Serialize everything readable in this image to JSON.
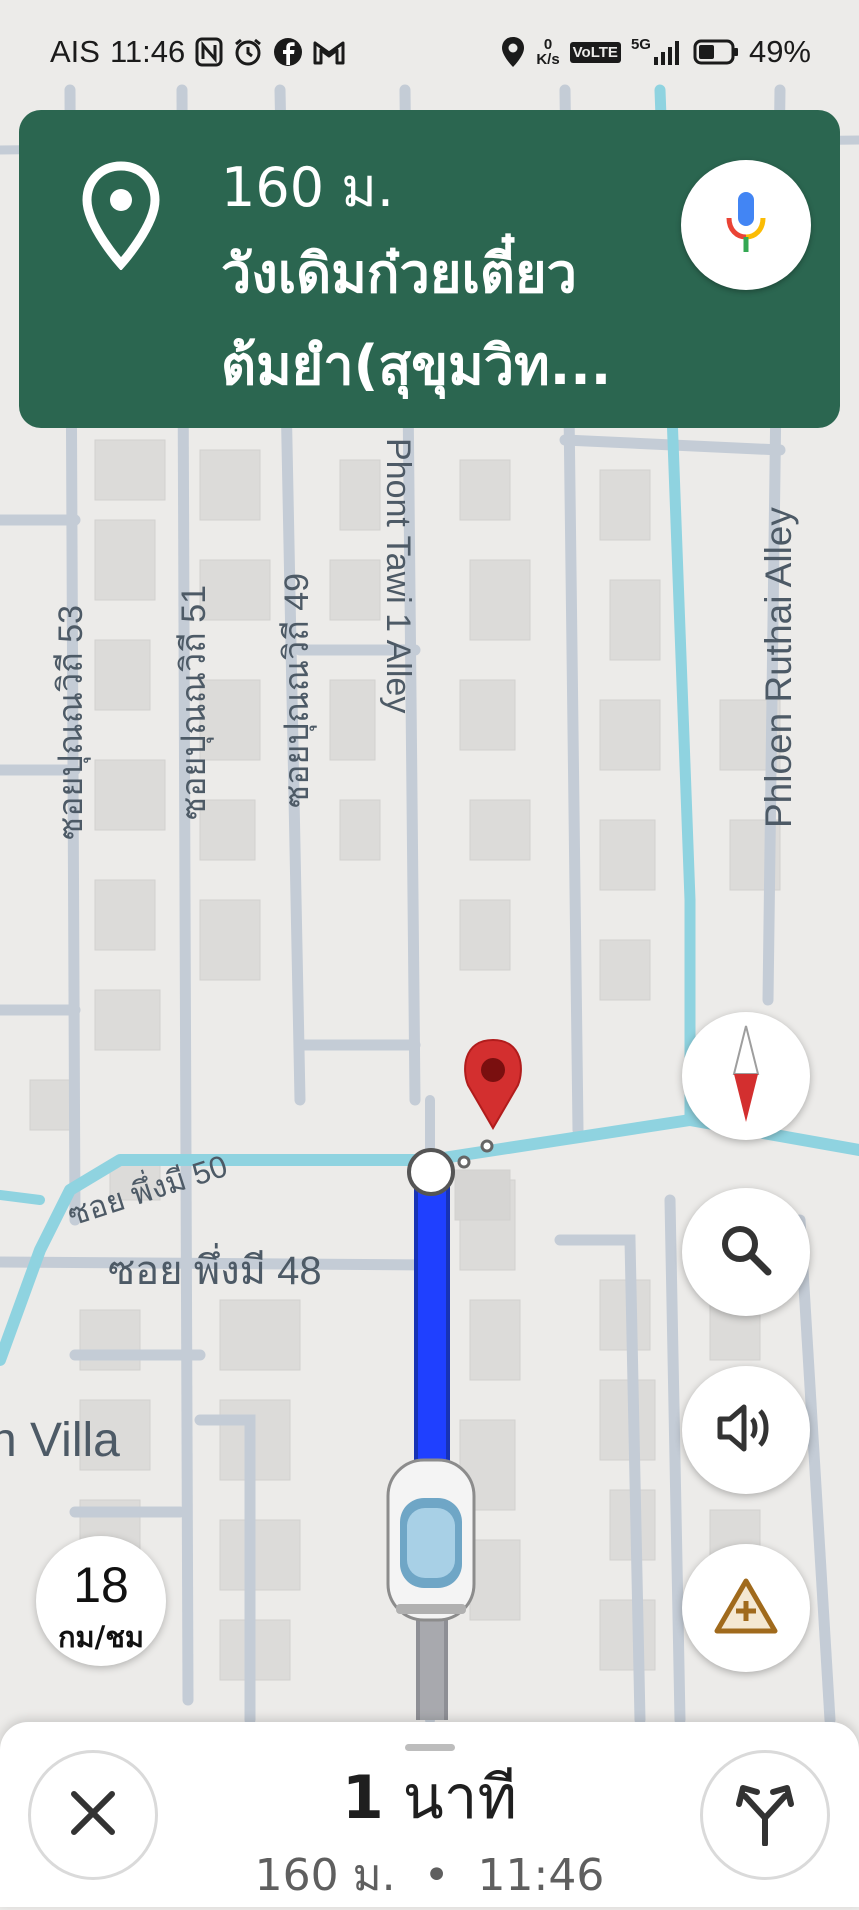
{
  "status_bar": {
    "carrier": "AIS",
    "time": "11:46",
    "left_icons": [
      "nfc-icon",
      "alarm-icon",
      "facebook-icon",
      "gmail-icon"
    ],
    "right_icons": [
      "location-icon",
      "network-speed-icon",
      "volte-icon",
      "signal-5g-icon",
      "battery-icon"
    ],
    "net_speed_value": "0",
    "net_speed_unit": "K/s",
    "volte": "VoLTE",
    "network": "5G",
    "battery": "49%"
  },
  "navigation": {
    "distance": "160 ม.",
    "destination": "วังเดิมก๋วยเตี๋ยวต้มยำ(สุขุมวิท..."
  },
  "map": {
    "street_labels": [
      "ซอยปุณณวิถี 53",
      "ซอยปุณณวิถี 51",
      "ซอยปุณณวิถี 49",
      "Phont Tawi 1 Alley",
      "Phloen Ruthai Alley",
      "ซอย พึ่งมี 50",
      "ซอย พึ่งมี 48",
      "n Villa"
    ],
    "route_color": "#1f40ff",
    "canal_color": "#8fd3e0",
    "pin_color": "#d32f2f"
  },
  "speed": {
    "value": "18",
    "unit": "กม/ชม"
  },
  "controls": [
    "compass-icon",
    "search-icon",
    "volume-icon",
    "report-incident-icon"
  ],
  "bottom": {
    "eta_number": "1",
    "eta_unit": "นาที",
    "distance": "160 ม.",
    "separator": "•",
    "arrival_time": "11:46"
  },
  "colors": {
    "nav_card": "#2b6650",
    "map_background": "#ecebe9"
  }
}
